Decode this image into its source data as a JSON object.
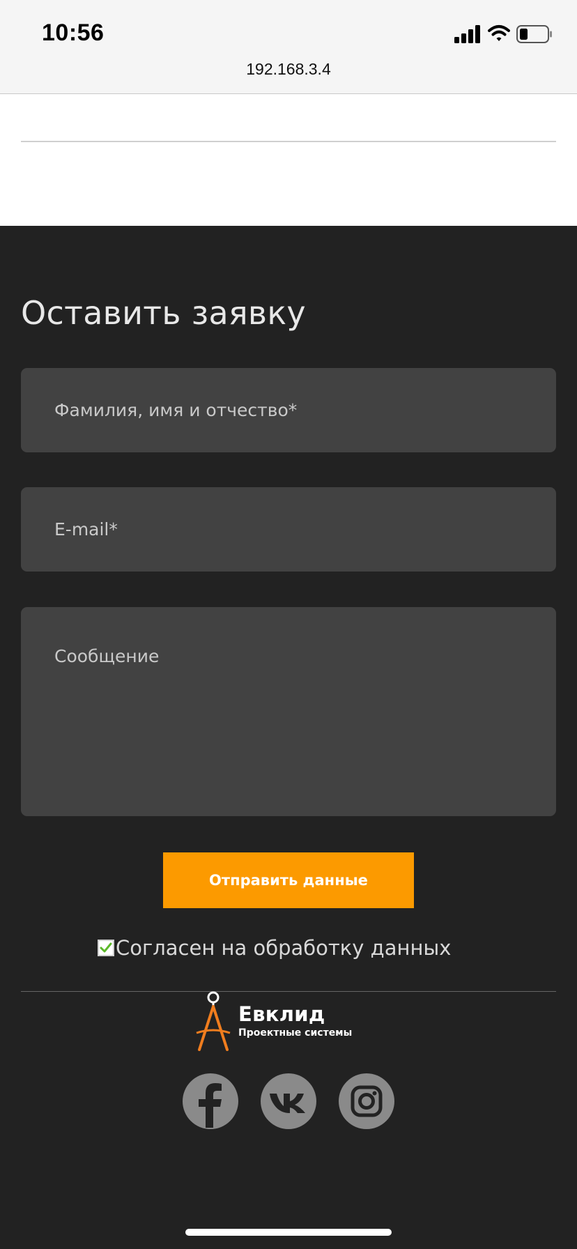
{
  "status_bar": {
    "time": "10:56",
    "icons": [
      "signal-icon",
      "wifi-icon",
      "battery-icon"
    ]
  },
  "browser": {
    "url": "192.168.3.4"
  },
  "form": {
    "title": "Оставить заявку",
    "name_placeholder": "Фамилия, имя и отчество*",
    "email_placeholder": "E-mail*",
    "message_placeholder": "Сообщение",
    "submit_label": "Отправить данные",
    "consent_label": "Согласен на обработку данных",
    "consent_checked": true
  },
  "footer": {
    "brand_name": "Евклид",
    "brand_tagline": "Проектные системы",
    "social_links": [
      "facebook-icon",
      "vk-icon",
      "instagram-icon"
    ]
  },
  "colors": {
    "page_background": "#222222",
    "field_background": "#424242",
    "accent": "#fc9a00",
    "social_circle": "#8a8a8a",
    "checkmark": "#5cb82a"
  }
}
